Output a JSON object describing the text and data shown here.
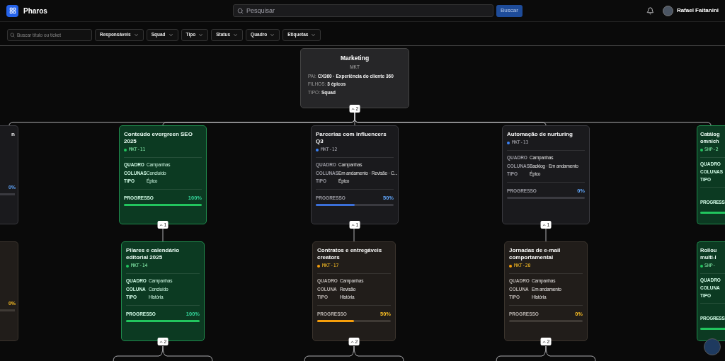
{
  "header": {
    "app_name": "Pharos",
    "search": {
      "placeholder": "Pesquisar"
    },
    "search_button": "Buscar",
    "user_name": "Rafael Faitanini"
  },
  "filters": {
    "search": {
      "placeholder": "Buscar título ou ticket"
    },
    "dropdowns": [
      "Responsáveis",
      "Squad",
      "Tipo",
      "Status",
      "Quadro",
      "Etiquetas"
    ]
  },
  "root": {
    "title": "Marketing",
    "code": "MKT",
    "fields": [
      {
        "label": "PAI:",
        "value": "CX360 · Experiência do cliente 360"
      },
      {
        "label": "FILHOS:",
        "value": "3 épicos"
      },
      {
        "label": "TIPO:",
        "value": "Squad"
      }
    ],
    "toggle": "2"
  },
  "rows": [
    {
      "left_edge": {
        "kind": "epic",
        "title": "n",
        "percent": "0%",
        "level": 0
      },
      "cards": [
        {
          "kind": "done",
          "title": "Conteúdo evergreen SEO 2025",
          "ticket": "MKT-11",
          "color": "#22c55e",
          "fields": [
            {
              "label": "QUADRO",
              "value": "Campanhas"
            },
            {
              "label": "COLUNAS",
              "value": "Concluído"
            },
            {
              "label": "TIPO",
              "value": "Épico"
            }
          ],
          "progress_label": "PROGRESSO",
          "percent": "100%",
          "level": 1,
          "toggle": "1"
        },
        {
          "kind": "epic",
          "title": "Parcerias com influencers Q3",
          "ticket": "MKT-12",
          "color": "#3b82f6",
          "fields": [
            {
              "label": "QUADRO",
              "value": "Campanhas"
            },
            {
              "label": "COLUNAS",
              "value": "Em andamento · Revisão · C..."
            },
            {
              "label": "TIPO",
              "value": "Épico"
            }
          ],
          "progress_label": "PROGRESSO",
          "percent": "50%",
          "level": 0.5,
          "toggle": "1"
        },
        {
          "kind": "epic",
          "title": "Automação de nurturing",
          "ticket": "MKT-13",
          "color": "#3b82f6",
          "fields": [
            {
              "label": "QUADRO",
              "value": "Campanhas"
            },
            {
              "label": "COLUNAS",
              "value": "Backlog · Em andamento"
            },
            {
              "label": "TIPO",
              "value": "Épico"
            }
          ],
          "progress_label": "PROGRESSO",
          "percent": "0%",
          "level": 0,
          "toggle": "1"
        }
      ],
      "right_edge": {
        "kind": "done",
        "title": "Catálog omnich",
        "ticket": "SHP-2",
        "color": "#22c55e",
        "labels": [
          "QUADRO",
          "COLUNAS",
          "TIPO"
        ],
        "progress_label": "PROGRESS",
        "level": 1
      }
    },
    {
      "left_edge": {
        "kind": "story",
        "percent": "0%",
        "level": 0
      },
      "cards": [
        {
          "kind": "done",
          "title": "Pilares e calendário editorial 2025",
          "ticket": "MKT-14",
          "color": "#22c55e",
          "fields": [
            {
              "label": "QUADRO",
              "value": "Campanhas"
            },
            {
              "label": "COLUNA",
              "value": "Concluído"
            },
            {
              "label": "TIPO",
              "value": "História"
            }
          ],
          "progress_label": "PROGRESSO",
          "percent": "100%",
          "level": 1,
          "toggle": "2"
        },
        {
          "kind": "story",
          "title": "Contratos e entregáveis creators",
          "ticket": "MKT-17",
          "color": "#f59e0b",
          "fields": [
            {
              "label": "QUADRO",
              "value": "Campanhas"
            },
            {
              "label": "COLUNA",
              "value": "Revisão"
            },
            {
              "label": "TIPO",
              "value": "História"
            }
          ],
          "progress_label": "PROGRESSO",
          "percent": "50%",
          "level": 0.5,
          "toggle": "2"
        },
        {
          "kind": "story",
          "title": "Jornadas de e-mail comportamental",
          "ticket": "MKT-20",
          "color": "#f59e0b",
          "fields": [
            {
              "label": "QUADRO",
              "value": "Campanhas"
            },
            {
              "label": "COLUNA",
              "value": "Em andamento"
            },
            {
              "label": "TIPO",
              "value": "História"
            }
          ],
          "progress_label": "PROGRESSO",
          "percent": "0%",
          "level": 0,
          "toggle": "2"
        }
      ],
      "right_edge": {
        "kind": "done",
        "title": "Rollou multi-l",
        "ticket": "SHP-",
        "color": "#22c55e",
        "labels": [
          "QUADRO",
          "COLUNA",
          "TIPO"
        ],
        "progress_label": "PROGRESS",
        "level": 1
      }
    }
  ]
}
